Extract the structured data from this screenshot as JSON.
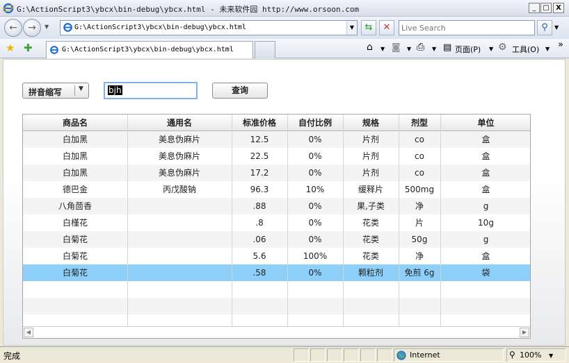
{
  "window": {
    "title": "G:\\ActionScript3\\ybcx\\bin-debug\\ybcx.html - 未来软件园 http://www.orsoon.com",
    "btn_min": "_",
    "btn_max": "□",
    "btn_close": "X"
  },
  "nav": {
    "url": "G:\\ActionScript3\\ybcx\\bin-debug\\ybcx.html",
    "search_placeholder": "Live Search"
  },
  "tab": {
    "label": "G:\\ActionScript3\\ybcx\\bin-debug\\ybcx.html"
  },
  "commands": {
    "page": "页面(P)",
    "tools": "工具(O)",
    "more": "»"
  },
  "app": {
    "mode_select": "拼音缩写",
    "query_value": "bjh",
    "query_button": "查询",
    "columns": [
      "商品名",
      "通用名",
      "标准价格",
      "自付比例",
      "规格",
      "剂型",
      "单位"
    ],
    "rows": [
      [
        "白加黑",
        "美息伪麻片",
        "12.5",
        "0%",
        "片剂",
        "co",
        "盒"
      ],
      [
        "白加黑",
        "美息伪麻片",
        "22.5",
        "0%",
        "片剂",
        "co",
        "盒"
      ],
      [
        "白加黑",
        "美息伪麻片",
        "17.2",
        "0%",
        "片剂",
        "co",
        "盒"
      ],
      [
        "德巴金",
        "丙戊酸钠",
        "96.3",
        "10%",
        "缓释片",
        "500mg",
        "盒"
      ],
      [
        "八角茴香",
        "",
        ".88",
        "0%",
        "果,子类",
        "净",
        "g"
      ],
      [
        "白槿花",
        "",
        ".8",
        "0%",
        "花类",
        "片",
        "10g"
      ],
      [
        "白菊花",
        "",
        ".06",
        "0%",
        "花类",
        "50g",
        "g"
      ],
      [
        "白菊花",
        "",
        "5.6",
        "100%",
        "花类",
        "净",
        "盒"
      ],
      [
        "白菊花",
        "",
        ".58",
        "0%",
        "颗粒剂",
        "免煎  6g",
        "袋"
      ]
    ],
    "selected_row": 8
  },
  "status": {
    "text": "完成",
    "zone": "Internet",
    "zoom": "100%"
  },
  "colors": {
    "selected_row": "#8fd0fb",
    "alt_row": "#f4f4f4"
  }
}
